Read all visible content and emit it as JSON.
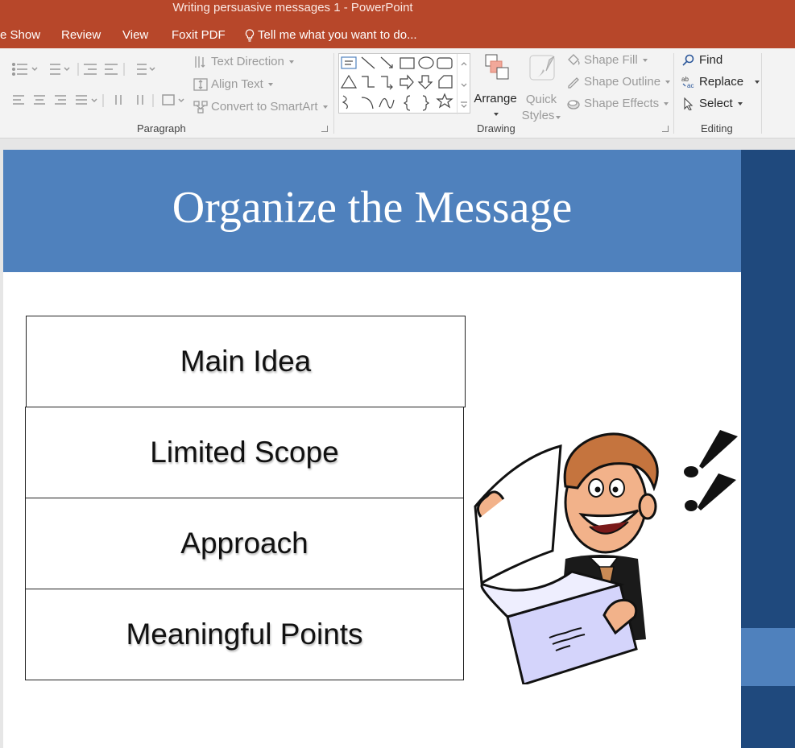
{
  "window": {
    "title": "Writing persuasive messages 1 - PowerPoint"
  },
  "tabs": [
    "e Show",
    "Review",
    "View",
    "Foxit PDF"
  ],
  "tell_me": "Tell me what you want to do...",
  "ribbon": {
    "paragraph": {
      "label": "Paragraph",
      "text_direction": "Text Direction",
      "align_text": "Align Text",
      "convert_smartart": "Convert to SmartArt"
    },
    "drawing": {
      "label": "Drawing",
      "arrange": "Arrange",
      "quick_styles_1": "Quick",
      "quick_styles_2": "Styles",
      "shape_fill": "Shape Fill",
      "shape_outline": "Shape Outline",
      "shape_effects": "Shape Effects"
    },
    "editing": {
      "label": "Editing",
      "find": "Find",
      "replace": "Replace",
      "select": "Select"
    }
  },
  "slide": {
    "title": "Organize the Message",
    "boxes": [
      "Main Idea",
      "Limited Scope",
      "Approach",
      "Meaningful Points"
    ]
  },
  "colors": {
    "titlebar": "#b7472a",
    "slide_header": "#4f81bd",
    "slide_sidebar": "#1f497d"
  }
}
